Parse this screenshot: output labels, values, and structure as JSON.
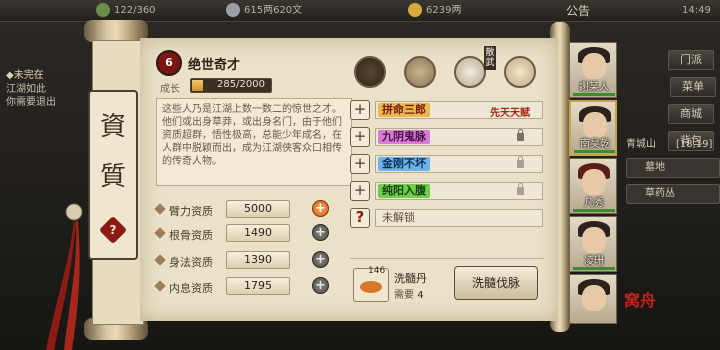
{
  "topbar": {
    "stat1": "122/360",
    "stat2": "615两620文",
    "stat3": "6239两",
    "menu_label": "公告",
    "clock": "14:49"
  },
  "quest": {
    "title": "未完在",
    "line1": "江湖如此",
    "line2": "你需要退出"
  },
  "side_menu": {
    "btn1": "门派",
    "btn2": "菜单",
    "btn3": "商城",
    "btn4": "背包",
    "location": "青城山",
    "coords": "[18,19]",
    "sub1": "墓地",
    "sub2": "草药丛"
  },
  "scroll": {
    "side_char1": "資",
    "side_char2": "質",
    "side_mark": "?"
  },
  "character": {
    "badge": "6",
    "title": "绝世奇才",
    "growth_label": "成长",
    "growth_text": "285/2000",
    "growth_current": 285,
    "growth_max": 2000,
    "description": "这些人乃是江湖上数一数二的惊世之才。他们或出身草莽，或出身名门，由于他们资质超群，悟性极高，总能少年成名，在人群中脱颖而出，成为江湖侠客众口相传的传奇人物。"
  },
  "equipment": {
    "item4_label": "散武"
  },
  "attributes": [
    {
      "label": "臂力资质",
      "value": "5000",
      "plus": "+"
    },
    {
      "label": "根骨资质",
      "value": "1490",
      "plus": "+"
    },
    {
      "label": "身法资质",
      "value": "1390",
      "plus": "+"
    },
    {
      "label": "内息资质",
      "value": "1795",
      "plus": "+"
    }
  ],
  "skills": [
    {
      "icon": "+",
      "name": "拼命三郎",
      "tag": "先天天赋"
    },
    {
      "icon": "+",
      "name": "九阴鬼脉"
    },
    {
      "icon": "+",
      "name": "金刚不坏"
    },
    {
      "icon": "+",
      "name": "纯阳入腹"
    },
    {
      "icon": "?",
      "name": "未解锁"
    }
  ],
  "pill": {
    "count": "146",
    "name": "洗髓丹",
    "need_label": "需要",
    "need_value": "4",
    "button": "洗髓伐脉"
  },
  "portraits": [
    {
      "name": "謝某人"
    },
    {
      "name": "南昊乾"
    },
    {
      "name": "凡秀"
    },
    {
      "name": "凌珊"
    },
    {
      "name": ""
    }
  ],
  "logo": "窝舟",
  "colors": {
    "accent_orange": "#e07a2a",
    "skill1": "#e9b84e",
    "skill2": "#d97ad6",
    "skill3": "#6bb3e8",
    "skill4": "#6fcf4a",
    "dark_red": "#7a1510"
  }
}
